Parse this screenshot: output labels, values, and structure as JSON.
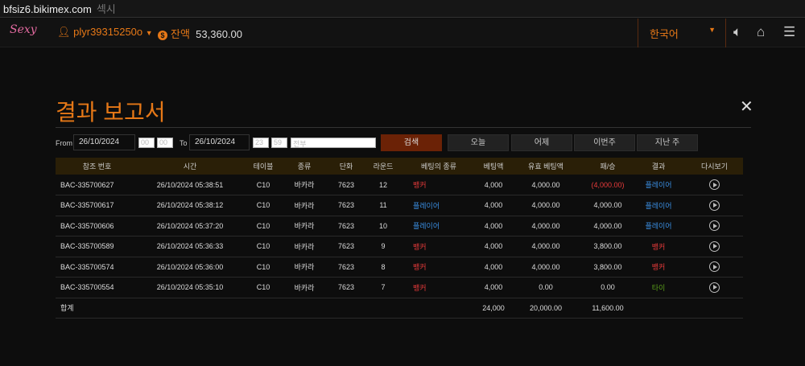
{
  "browser": {
    "url": "bfsiz6.bikimex.com",
    "title": "섹시"
  },
  "header": {
    "logo": "Sexy",
    "username": "plyr39315250o",
    "balance_label": "잔액",
    "balance": "53,360.00",
    "language": "한국어"
  },
  "report": {
    "title": "결과 보고서",
    "from_label": "From",
    "from_date": "26/10/2024",
    "from_hour": "00",
    "from_min": "00",
    "to_label": "To",
    "to_date": "26/10/2024",
    "to_hour": "23",
    "to_min": "59",
    "type_select": "전부",
    "search": "검색",
    "today": "오늘",
    "yesterday": "어제",
    "this_week": "이번주",
    "last_week": "지난 주"
  },
  "table": {
    "headers": [
      "참조 번호",
      "시간",
      "테이블",
      "종류",
      "단화",
      "라운드",
      "베팅의 종류",
      "베팅액",
      "유효 베팅액",
      "패/승",
      "결과",
      "다시보기"
    ],
    "rows": [
      [
        "BAC-335700627",
        "26/10/2024 05:38:51",
        "C10",
        "바카라",
        "7623",
        "12",
        "뱅커",
        "4,000",
        "4,000.00",
        "(4,000.00)",
        "플레이어"
      ],
      [
        "BAC-335700617",
        "26/10/2024 05:38:12",
        "C10",
        "바카라",
        "7623",
        "11",
        "플레이어",
        "4,000",
        "4,000.00",
        "4,000.00",
        "플레이어"
      ],
      [
        "BAC-335700606",
        "26/10/2024 05:37:20",
        "C10",
        "바카라",
        "7623",
        "10",
        "플레이어",
        "4,000",
        "4,000.00",
        "4,000.00",
        "플레이어"
      ],
      [
        "BAC-335700589",
        "26/10/2024 05:36:33",
        "C10",
        "바카라",
        "7623",
        "9",
        "뱅커",
        "4,000",
        "4,000.00",
        "3,800.00",
        "뱅커"
      ],
      [
        "BAC-335700574",
        "26/10/2024 05:36:00",
        "C10",
        "바카라",
        "7623",
        "8",
        "뱅커",
        "4,000",
        "4,000.00",
        "3,800.00",
        "뱅커"
      ],
      [
        "BAC-335700554",
        "26/10/2024 05:35:10",
        "C10",
        "바카라",
        "7623",
        "7",
        "뱅커",
        "4,000",
        "0.00",
        "0.00",
        "타이"
      ]
    ],
    "total": {
      "label": "합계",
      "bet": "24,000",
      "valid": "20,000.00",
      "winloss": "11,600.00"
    }
  },
  "colors": {
    "accent": "#e67817",
    "banker": "#e93b3b",
    "player": "#3a8de0",
    "tie": "#5a9e1a"
  }
}
